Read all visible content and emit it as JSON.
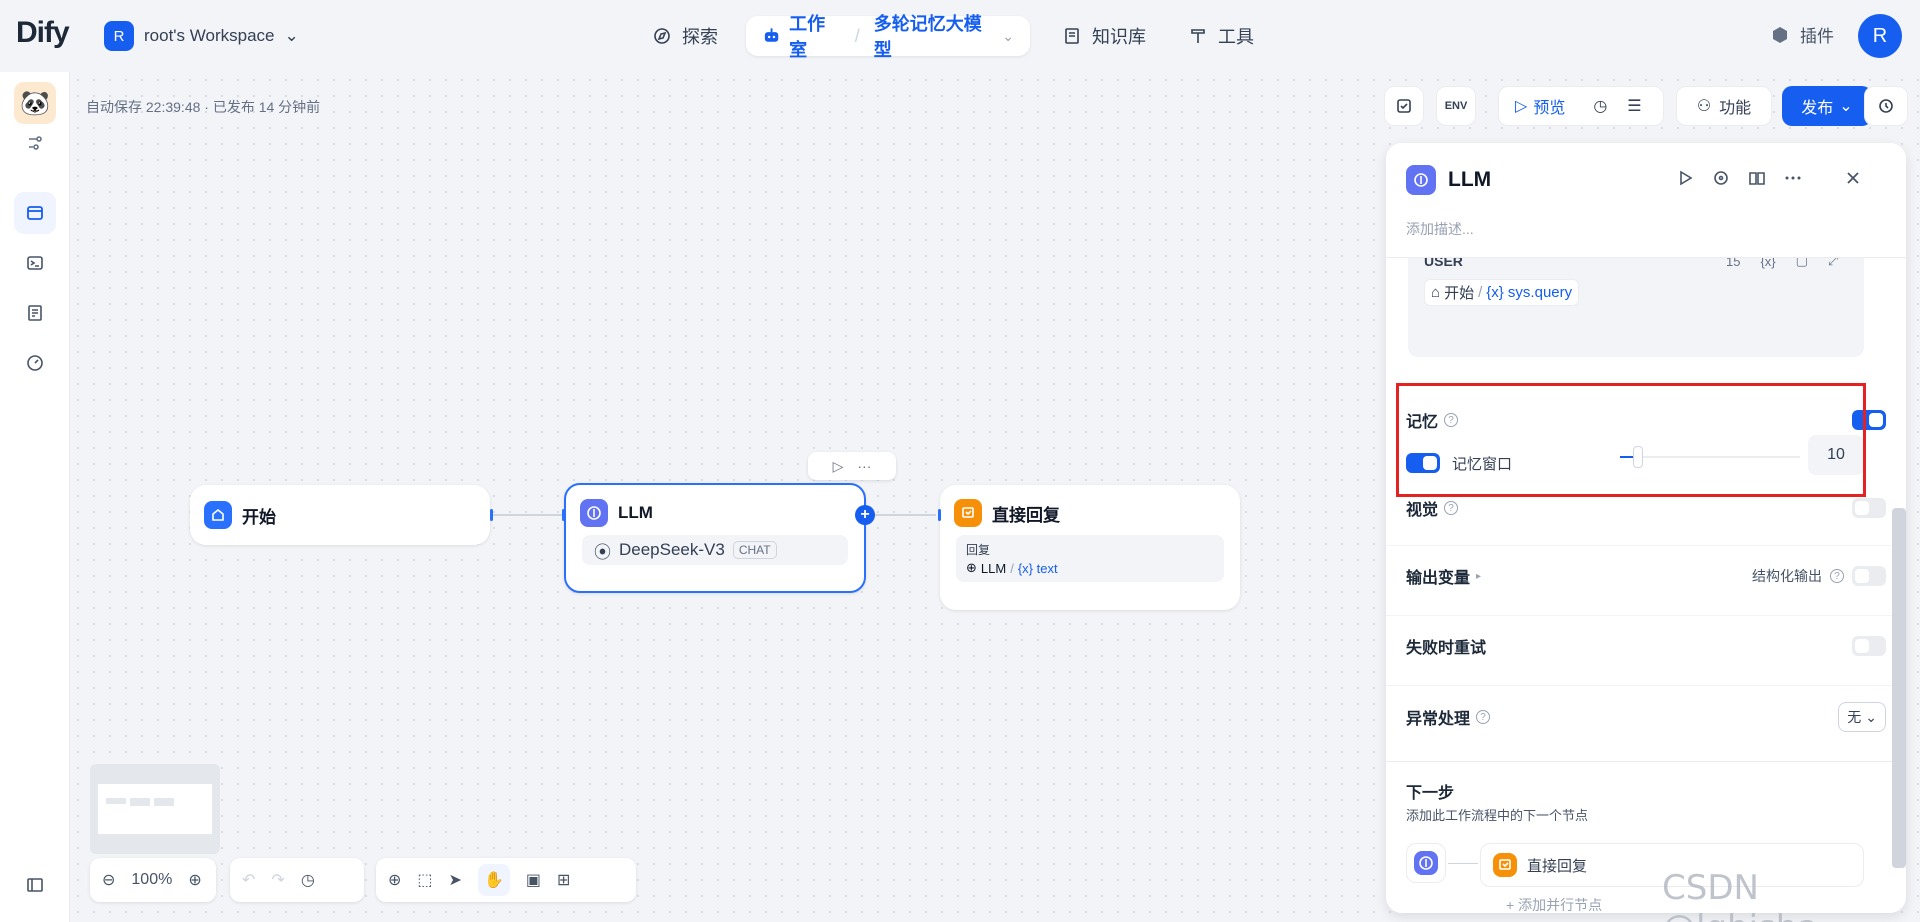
{
  "app": {
    "logo": "Dify",
    "workspace_initial": "R",
    "workspace_name": "root's Workspace"
  },
  "nav": {
    "explore": "探索",
    "studio": "工作室",
    "app_name": "多轮记忆大模型",
    "knowledge": "知识库",
    "tools": "工具"
  },
  "header_right": {
    "plugins": "插件",
    "user_initial": "R"
  },
  "canvas": {
    "autosave": "自动保存 22:39:48 · 已发布 14 分钟前"
  },
  "toolbar": {
    "env": "ENV",
    "preview": "预览",
    "features": "功能",
    "publish": "发布"
  },
  "nodes": {
    "start": {
      "title": "开始"
    },
    "llm": {
      "title": "LLM",
      "model": "DeepSeek-V3",
      "mode": "CHAT"
    },
    "answer": {
      "title": "直接回复",
      "reply_label": "回复",
      "var_node": "LLM",
      "var_sep": "/",
      "var_name": "{x} text"
    }
  },
  "panel": {
    "title": "LLM",
    "description_placeholder": "添加描述...",
    "user_label": "USER",
    "token_count": "15",
    "var_tool": "{x}",
    "user_var_node": "开始",
    "user_var_sep": "/",
    "user_var_name": "{x} sys.query",
    "memory_label": "记忆",
    "memory_enabled": true,
    "memory_window_label": "记忆窗口",
    "memory_window_enabled": true,
    "memory_window_value": "10",
    "memory_window_slider": 0.1,
    "vision_label": "视觉",
    "vision_enabled": false,
    "output_vars_label": "输出变量",
    "structured_output_label": "结构化输出",
    "structured_output_enabled": false,
    "retry_label": "失败时重试",
    "retry_enabled": false,
    "error_handling_label": "异常处理",
    "error_handling_value": "无",
    "next_step_title": "下一步",
    "next_step_desc": "添加此工作流程中的下一个节点",
    "next_node_label": "直接回复",
    "add_parallel": "添加并行节点"
  },
  "bottom": {
    "zoom": "100%"
  },
  "watermark": "CSDN @lgbisha",
  "colors": {
    "accent": "#155eef",
    "highlight_border": "#e62121"
  }
}
